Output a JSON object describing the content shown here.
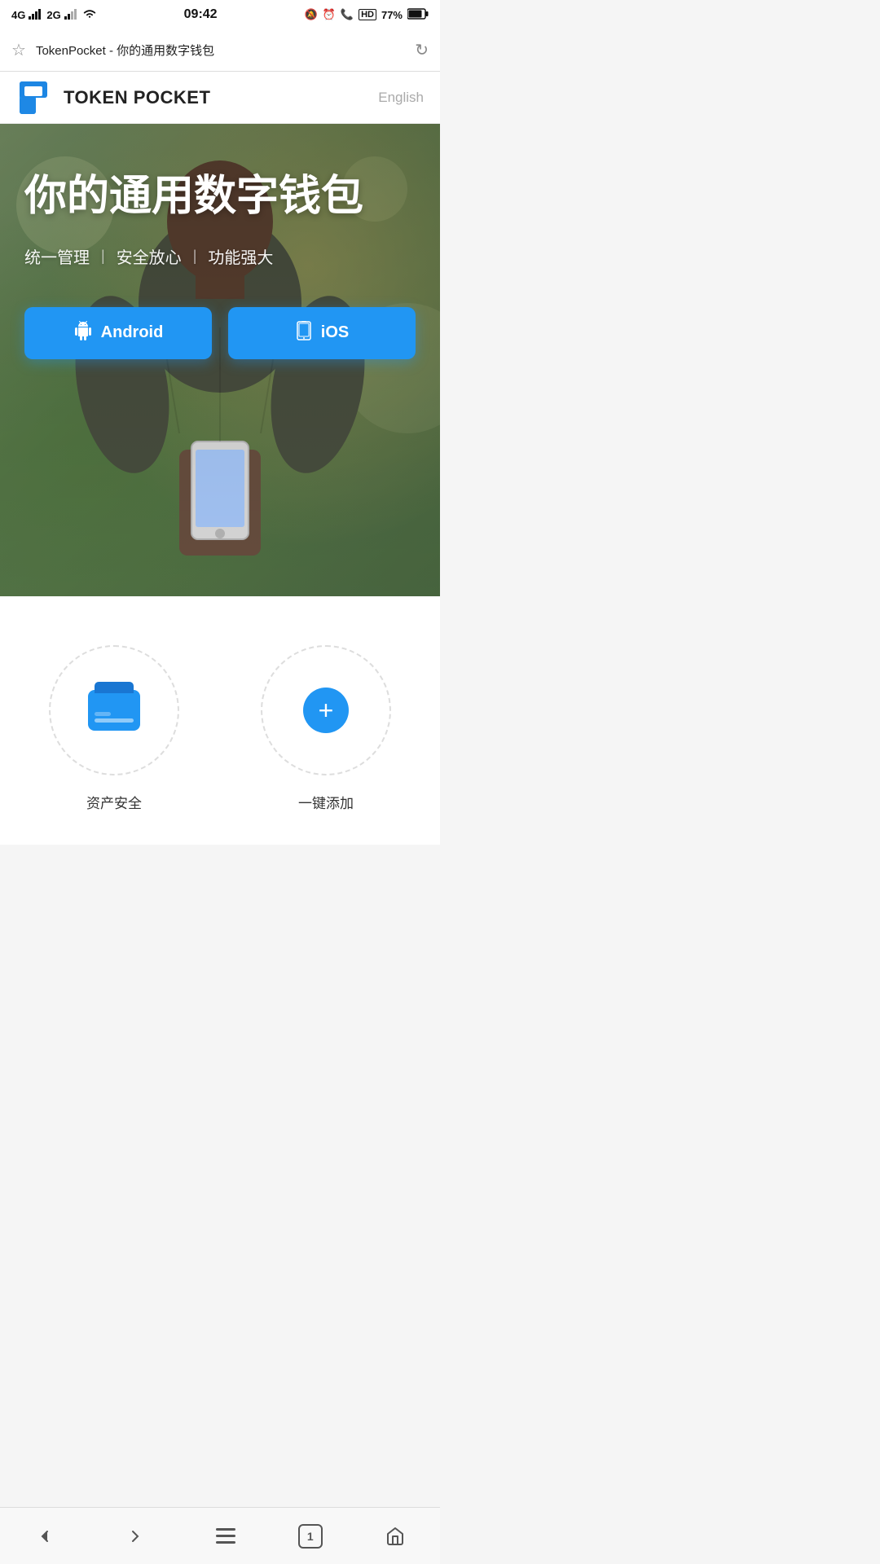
{
  "statusBar": {
    "network1": "4G",
    "network2": "2G",
    "time": "09:42",
    "battery": "77%"
  },
  "addressBar": {
    "star": "☆",
    "url": "TokenPocket - 你的通用数字钱包",
    "reload": "↻"
  },
  "nav": {
    "logoText": "TOKEN POCKET",
    "langButton": "English"
  },
  "hero": {
    "title": "你的通用数字钱包",
    "subtitle1": "统一管理",
    "subtitle2": "安全放心",
    "subtitle3": "功能强大",
    "androidBtn": "Android",
    "iosBtn": "iOS"
  },
  "features": {
    "card1": {
      "label": "资产安全"
    },
    "card2": {
      "label": "一键添加"
    }
  },
  "browserNav": {
    "back": "‹",
    "forward": "›",
    "menu": "≡",
    "tabs": "1",
    "home": "⌂"
  }
}
